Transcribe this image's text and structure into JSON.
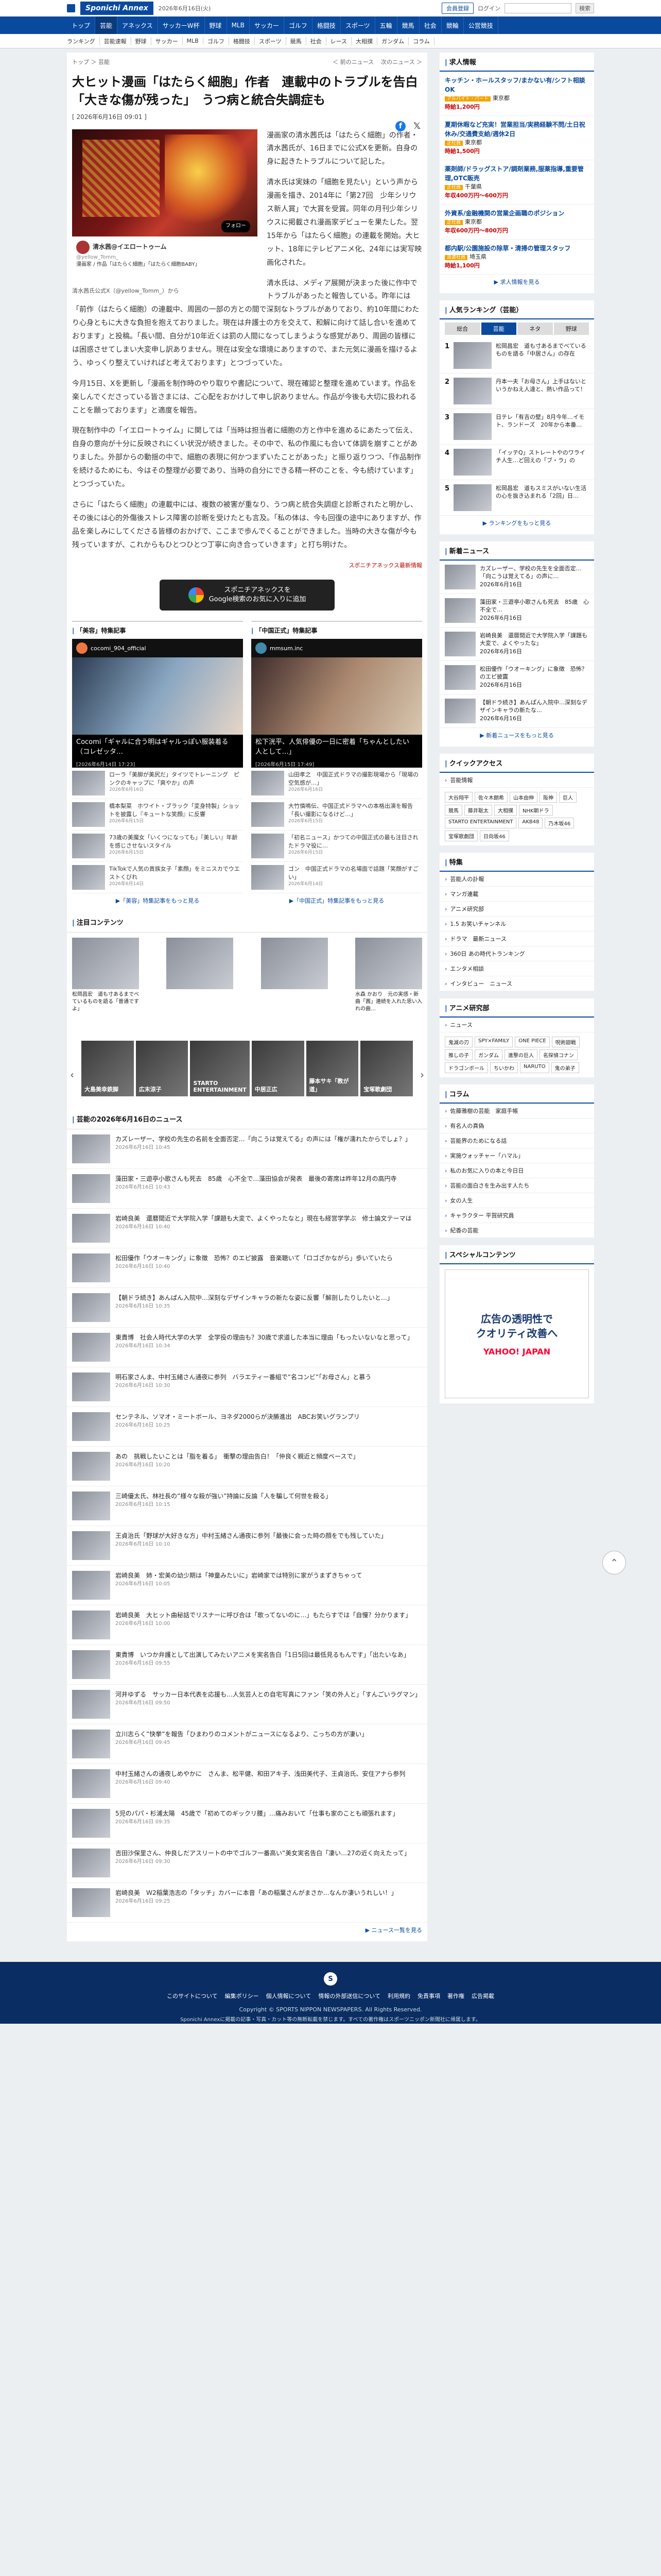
{
  "header": {
    "logo": "Sponichi Annex",
    "date_text": "2026年6月16日(火)",
    "member_btn": "会員登録",
    "login_btn": "ログイン",
    "search_btn": "検索"
  },
  "gnav": [
    "トップ",
    "芸能",
    "アネックス",
    "サッカーW杯",
    "野球",
    "MLB",
    "サッカー",
    "ゴルフ",
    "格闘技",
    "スポーツ",
    "五輪",
    "競馬",
    "社会",
    "競輪",
    "公営競技"
  ],
  "subnav": [
    "ランキング",
    "芸能速報",
    "野球",
    "サッカー",
    "MLB",
    "ゴルフ",
    "格闘技",
    "スポーツ",
    "競馬",
    "社会",
    "レース",
    "大相撲",
    "ガンダム",
    "コラム"
  ],
  "crumb": "トップ ＞ 芸能",
  "crumb_nav": [
    "＜ 前のニュース",
    "次のニュース ＞"
  ],
  "article": {
    "title": "大ヒット漫画「はたらく細胞」作者　連載中のトラブルを告白「大きな傷が残った」　うつ病と統合失調症も",
    "date": "[ 2026年6月16日 09:01 ]",
    "photo_caption": "清水茜氏公式X（@yellow_Tomm_）から",
    "photo_panel_name": "清水茜@イエロートゥーム",
    "photo_panel_handle": "@yellow_Tomm_",
    "photo_panel_text": "漫画家 / 作品「はたらく細胞」「はたらく細胞BABY」",
    "follow_label": "フォロー",
    "paragraphs": [
      "漫画家の清水茜氏は「はたらく細胞」の作者・清水茜氏が、16日までに公式Xを更新。自身の身に起きたトラブルについて記した。",
      "清水氏は実妹の「細胞を見たい」という声から漫画を描き、2014年に「第27回　少年シリウス新人賞」で大賞を受賞。同年の月刊少年シリウスに掲載され漫画家デビューを果たした。翌15年から「はたらく細胞」の連載を開始。大ヒット、18年にテレビアニメ化、24年には実写映画化された。",
      "清水氏は、メディア展開が決まった後に作中でトラブルがあったと報告している。昨年には「前作（はたらく細胞）の連載中、周囲の一部の方との間で深刻なトラブルがありており、約10年間にわたり心身ともに大きな負担を抱えておりました。現在は弁護士の方を交えて、和解に向けて話し合いを進めております」と投稿。「長い間、自分が10年近くは罰の人間になってしまうような感覚があり、周囲の皆様には困惑させてしまい大変申し訳ありません。現在は安全な環境にありますので、また元気に漫画を描けるよう、ゆっくり整えていければと考えております」とつづっていた。",
      "今月15日、Xを更新し「漫画を制作時のやり取りや書記について、現在確認と整理を進めています。作品を楽しんでくださっている皆さまには、ご心配をおかけして申し訳ありません。作品が今後も大切に扱われることを願っております」と適度を報告。",
      "現在制作中の「イエロートゥイム」に関しては「当時は担当者に細胞の方と作中を進めるにあたって伝え、自身の意向が十分に反映されにくい状況が続きました。その中で、私の作風にも合いて体調を崩すことがありました。外部からの動揺の中で、細胞の表現に何かつまずいたことがあった」と振り返りつつ、「作品制作を続けるためにも、今はその整理が必要であり、当時の自分にできる精一杯のことを、今も続けています」とつづっていた。",
      "さらに「はたらく細胞」の連載中には、複数の被害が重なり、うつ病と統合失調症と診断されたと明かし、その後には心的外傷後ストレス障害の診断を受けたとも言及。「私の体は、今も回復の途中にありますが、作品を楽しみにしてくださる皆様のおかげで、ここまで歩んでくることができました。当時の大きな傷が今も残っていますが、これからもひとつひとつ丁寧に向き合っていきます」と打ち明けた。"
    ],
    "source": "スポニチアネックス最新情報",
    "google_btn": "スポニチアネックスを\nGoogle検索のお気に入りに追加"
  },
  "feature": {
    "left_title": "「美容」特集記事",
    "right_title": "「中国正式」特集記事",
    "left_insta_user": "cocomi_904_official",
    "right_insta_user": "mmsum.inc",
    "left_insta_text": "Cocomi「ギャルに合う明はギャルっぽい服装着る（コレゼッタ…",
    "left_insta_date": "[2026年6月14日 17:23]",
    "right_insta_text": "松下洸平、人気俳優の一日に密着「ちゃんとしたい　人として…」",
    "right_insta_date": "[2026年6月15日 17:49]",
    "left_items": [
      {
        "t": "ローラ「美脚が美尻だ」タイツでトレーニング　ピンクのキャップに「爽やか」の声",
        "m": "2026年6月16日"
      },
      {
        "t": "橋本梨菜　ホワイト・ブラック「変身特製」ショットを披露し『キュートな笑顔』に反響",
        "m": "2026年6月15日"
      },
      {
        "t": "73歳の美魔女「いくつになっても」『美しい』年齢を感じさせないスタイル",
        "m": "2026年6月15日"
      },
      {
        "t": "TikTokで人気の貴族女子「素顔」をミニスカでウエストくびれ",
        "m": "2026年6月14日"
      }
    ],
    "right_items": [
      {
        "t": "山田孝之　中国正式ドラマの撮影現場から「現場の空気感が…」",
        "m": "2026年6月16日"
      },
      {
        "t": "大竹慎鳴伝、中国正式ドラマへの本格出演を報告「長い撮影になるけど…」",
        "m": "2026年6月15日"
      },
      {
        "t": "「初名ニュース」かつての中国正式の最も注目されたドラマ役に…",
        "m": "2026年6月15日"
      },
      {
        "t": "ゴン　中国正式ドラマの名場面で話題「笑顔がすごい」",
        "m": "2026年6月14日"
      }
    ],
    "more_left": "▶「美容」特集記事をもっと見る",
    "more_right": "▶「中国正式」特集記事をもっと見る"
  },
  "attention": {
    "title": "注目コンテンツ",
    "items": [
      {
        "t": "松岡昌宏　道も寸あるまでべているものを語る「普通ですよ」",
        "m": ""
      },
      {
        "t": "",
        "m": ""
      },
      {
        "t": "",
        "m": ""
      },
      {
        "t": "水森 かおり　元の実感・新曲「茜」連続を入れた思い入れの曲…",
        "m": ""
      }
    ]
  },
  "carousel": [
    "大島美幸鉄脚",
    "広末涼子",
    "STARTO ENTERTAINMENT",
    "中居正広",
    "藤本サキ「教が道」",
    "宝塚歌劇団"
  ],
  "news_list": {
    "title": "芸能の2026年6月16日のニュース",
    "items": [
      {
        "t": "カズレーザー、学校の先生の名前を全面否定…「向こうは覚えてる」の声には「権が濡れたからでしょ？」",
        "m": "2026年6月16日 10:45"
      },
      {
        "t": "藻田家・三遊亭小歌さんも死去　85歳　心不全で…藻田協会が発表　最後の寄席は昨年12月の高円寺",
        "m": "2026年6月16日 10:43"
      },
      {
        "t": "岩崎良美　還暦間近で大学院入学「課題も大変で、よくやったなと」現在も経営学学ぶ　修士論文テーマは",
        "m": "2026年6月16日 10:40"
      },
      {
        "t": "松田優作「ウオーキング」に象徴　恐怖？のエピ披露　音楽聴いて「ロゴざかながら」歩いていたら",
        "m": "2026年6月16日 10:40"
      },
      {
        "t": "【朝ドラ続き】あんぱん入院中…深刻なデザインキャラの新たな姿に反響「解剖したりしたいと…」",
        "m": "2026年6月16日 10:35"
      },
      {
        "t": "東貴博　社会人時代大学の大学　全学役の理由も？30歳で求道した本当に理由「もったいないなと思って」",
        "m": "2026年6月16日 10:34"
      },
      {
        "t": "明石家さんま、中村玉緒さん通夜に参列　バラエティー番組で”名コンビ”「お母さん」と慕う",
        "m": "2026年6月16日 10:30"
      },
      {
        "t": "センテネル、ソマオ・ミートボール、ヨネダ2000らが決勝進出　ABCお笑いグランプリ",
        "m": "2026年6月16日 10:25"
      },
      {
        "t": "あの　挑戦したいことは「脂を着る」　衝撃の理由告白！「仲良く親近と頻度ベースで」",
        "m": "2026年6月16日 10:20"
      },
      {
        "t": "三崎優太氏、林社長の”様々な殺が強い”持論に反論「人を騙して何世を殺る」",
        "m": "2026年6月16日 10:15"
      },
      {
        "t": "王貞治氏「野球が大好きな方」中村玉緒さん通夜に参列「最後に会った時の顔をでも残していた」",
        "m": "2026年6月16日 10:10"
      },
      {
        "t": "岩崎良美　姉・宏美の幼少期は「神童みたいに」岩崎家では特別に家がうまずきちゃって",
        "m": "2026年6月16日 10:05"
      },
      {
        "t": "岩崎良美　大ヒット曲秘話でリスナーに呼び合は「歌ってないのに…」もたらすでは「自慢？分かります」",
        "m": "2026年6月16日 10:00"
      },
      {
        "t": "東貴博　いつか弁護として出演してみたいアニメを実名告白「1日5回は最低見るもんです」「出たいなあ」",
        "m": "2026年6月16日 09:55"
      },
      {
        "t": "河井ゆずる　サッカー日本代表を応援も…人気芸人との自宅写真にファン「笑の外人と」「すんごいラグマン」",
        "m": "2026年6月16日 09:50"
      },
      {
        "t": "立川志らく”快挙”を報告「ひまわりのコメントがニュースになるより、こっちの方が凄い」",
        "m": "2026年6月16日 09:45"
      },
      {
        "t": "中村玉緒さんの通夜しめやかに　さんま、松平健、和田アキ子、浅田美代子、王貞治氏、安住アナら参列",
        "m": "2026年6月16日 09:40"
      },
      {
        "t": "5児のパパ・杉浦太陽　45歳で「初めてのギックリ腰」…痛みおいて「仕事も家のことも頑張れます」",
        "m": "2026年6月16日 09:35"
      },
      {
        "t": "吉田沙保里さん、仲良しだアスリートの中でゴルフ一番高い”美女実名告白「凄い…27の近く向えたって」",
        "m": "2026年6月16日 09:30"
      },
      {
        "t": "岩崎良美　Ｗ2稲葉浩志の「タッチ」カバーに本音「あの稲葉さんがまさか…なんか凄いうれしい！」",
        "m": "2026年6月16日 09:25"
      }
    ],
    "more": "▶ ニュース一覧を見る"
  },
  "side": {
    "jobs_title": "求人情報",
    "jobs": [
      {
        "t": "キッチン・ホールスタッフ/まかない有/シフト相談OK",
        "tag": "アルバイト・パート",
        "loc": "東京都",
        "wage": "時給1,200円"
      },
      {
        "t": "夏期休暇など充実！営業担当/実務経験不問/土日祝休み/交通費支給/週休2日",
        "tag": "正社員",
        "loc": "東京都",
        "wage": "時給1,500円"
      },
      {
        "t": "薬剤師/ドラッグストア/調剤業務,服薬指導,重要管理,OTC販売",
        "tag": "正社員",
        "loc": "千葉県",
        "wage": "年収400万円〜600万円"
      },
      {
        "t": "外資系/金融機関の営業企画職のポジション",
        "tag": "正社員",
        "loc": "東京都",
        "wage": "年収600万円〜800万円"
      },
      {
        "t": "都内駅/公園施設の除草・清掃の管理スタッフ",
        "tag": "派遣社員",
        "loc": "埼玉県",
        "wage": "時給1,100円"
      }
    ],
    "jobs_more": "▶ 求人情報を見る",
    "ranking_title": "人気ランキング（芸能）",
    "ranking_tabs": [
      "総合",
      "芸能",
      "ネタ",
      "野球"
    ],
    "ranking": [
      {
        "n": "1",
        "t": "松岡昌宏　道も寸あるまでべているものを語る「中居さん」の存在"
      },
      {
        "n": "2",
        "t": "丹本一夫「お母さん」上手はないというかねえ人達と、熱い作品って！"
      },
      {
        "n": "3",
        "t": "日テレ「有吉の壁」8月今年…イモト、ランドーズ　20年から本番…"
      },
      {
        "n": "4",
        "t": "「イッテQ」ストレートやのワライチ人生…ど回えの「ブ・ラ」の"
      },
      {
        "n": "5",
        "t": "松岡昌宏　道もスミスがいない生活の心を抜き込まれる「2回」日…"
      }
    ],
    "ranking_more": "▶ ランキングをもっと見る",
    "news_title": "新着ニュース",
    "news": [
      {
        "t": "カズレーザー、学校の先生を全面否定…「向こうは覚えてる」の声に…",
        "m": "2026年6月16日"
      },
      {
        "t": "藻田家・三遊亭小歌さんも死去　85歳　心不全で…",
        "m": "2026年6月16日"
      },
      {
        "t": "岩崎良美　還暦間近で大学院入学「課題も大変で、よくやったな」",
        "m": "2026年6月16日"
      },
      {
        "t": "松田優作「ウオーキング」に象徴　恐怖？のエピ披露",
        "m": "2026年6月16日"
      },
      {
        "t": "【朝ドラ続き】あんぱん入院中…深刻なデザインキャラの新たな…",
        "m": "2026年6月16日"
      }
    ],
    "news_more": "▶ 新着ニュースをもっと見る",
    "quick_title": "クイックアクセス",
    "quick_sub": "芸能情報",
    "quick": [
      "大谷翔平",
      "佐々木朗希",
      "山本由伸",
      "阪神",
      "巨人",
      "競馬",
      "藤井聡太",
      "大相撲",
      "NHK朝ドラ",
      "STARTO ENTERTAINMENT",
      "AKB48",
      "乃木坂46",
      "宝塚歌劇団",
      "日向坂46"
    ],
    "special_title": "特集",
    "special": [
      "芸能人の訃報",
      "マンガ連載",
      "アニメ研究部",
      "1.5 お笑いチャンネル",
      "ドラマ　最新ニュース",
      "360日 あの時代トランキング",
      "エンタメ相談",
      "インタビュー　ニュース"
    ],
    "anime_title": "アニメ研究部",
    "anime_sub": "ニュース",
    "anime": [
      "鬼滅の刃",
      "SPY×FAMILY",
      "ONE PIECE",
      "呪術廻戦",
      "推しの子",
      "ガンダム",
      "進撃の巨人",
      "名探偵コナン",
      "ドラゴンボール",
      "ちいかわ",
      "NARUTO",
      "鬼の弟子"
    ],
    "column_title": "コラム",
    "column": [
      "佐藤雅樹の芸能　家庭手帳",
      "有名人の真偽",
      "芸能界のためになる話",
      "実施ウォッチャー「ハマル」",
      "私のお気に入りの本と今日日",
      "芸能の面白さを生み出す人たち",
      "女の人生",
      "キャラクター 平賀研究員",
      "紀香の芸能"
    ],
    "sp_title": "スペシャルコンテンツ",
    "ad_text": "広告の透明性で\nクオリティ改善へ",
    "ad_brand": "YAHOO! JAPAN"
  },
  "footer": {
    "links": [
      "このサイトについて",
      "編集ポリシー",
      "個人情報について",
      "情報の外部送信について",
      "利用規約",
      "免責事項",
      "著作権",
      "広告掲載"
    ],
    "copyright": "Copyright © SPORTS NIPPON NEWSPAPERS. All Rights Reserved.",
    "note": "Sponichi Annexに掲載の記事・写真・カット等の無断転載を禁じます。すべての著作権はスポーツニッポン新聞社に帰属します。",
    "logo": "S"
  }
}
